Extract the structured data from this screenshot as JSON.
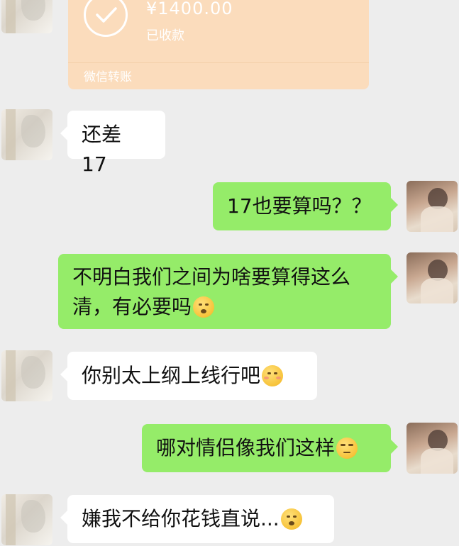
{
  "transfer": {
    "amount": "¥1400.00",
    "status": "已收款",
    "footer": "微信转账"
  },
  "messages": [
    {
      "side": "in",
      "text": "还差 17"
    },
    {
      "side": "out",
      "text": "17也要算吗？？"
    },
    {
      "side": "out",
      "text_line1": "不明白我们之间为啥要算得这么",
      "text_line2": "清，有必要吗"
    },
    {
      "side": "in",
      "text": "你别太上纲上线行吧"
    },
    {
      "side": "out",
      "text": "哪对情侣像我们这样"
    },
    {
      "side": "in",
      "text": "嫌我不给你花钱直说..."
    }
  ],
  "emojis": [
    "shocked-face-icon",
    "blushing-face-icon",
    "eyeroll-face-icon",
    "shocked-face-icon"
  ]
}
